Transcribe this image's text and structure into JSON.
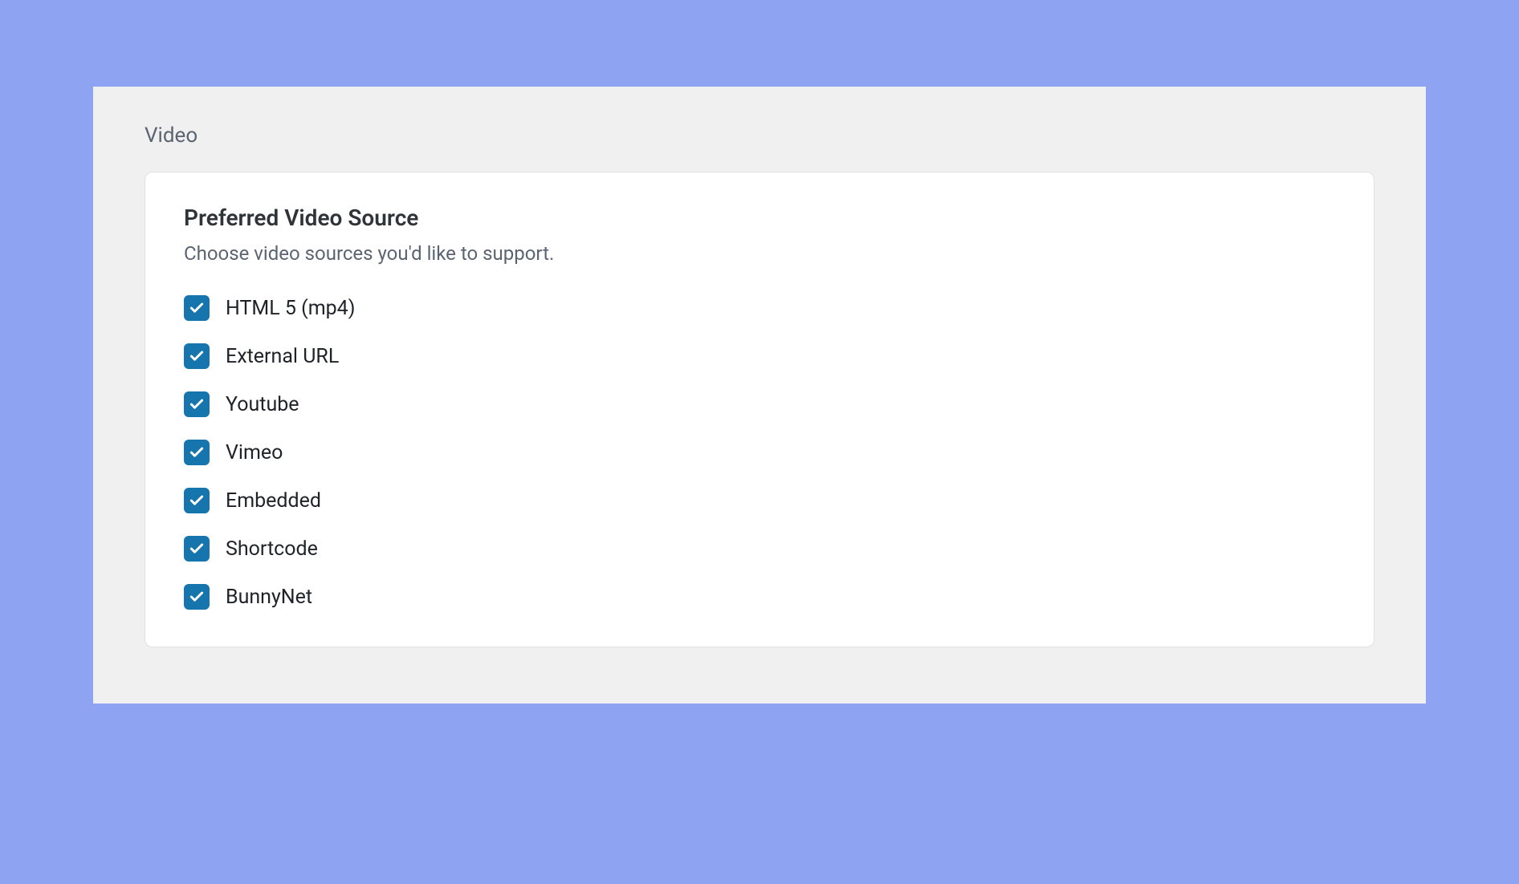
{
  "section": {
    "label": "Video"
  },
  "card": {
    "title": "Preferred Video Source",
    "description": "Choose video sources you'd like to support."
  },
  "options": [
    {
      "id": "html5",
      "label": "HTML 5 (mp4)",
      "checked": true
    },
    {
      "id": "external",
      "label": "External URL",
      "checked": true
    },
    {
      "id": "youtube",
      "label": "Youtube",
      "checked": true
    },
    {
      "id": "vimeo",
      "label": "Vimeo",
      "checked": true
    },
    {
      "id": "embedded",
      "label": "Embedded",
      "checked": true
    },
    {
      "id": "shortcode",
      "label": "Shortcode",
      "checked": true
    },
    {
      "id": "bunnynet",
      "label": "BunnyNet",
      "checked": true
    }
  ]
}
